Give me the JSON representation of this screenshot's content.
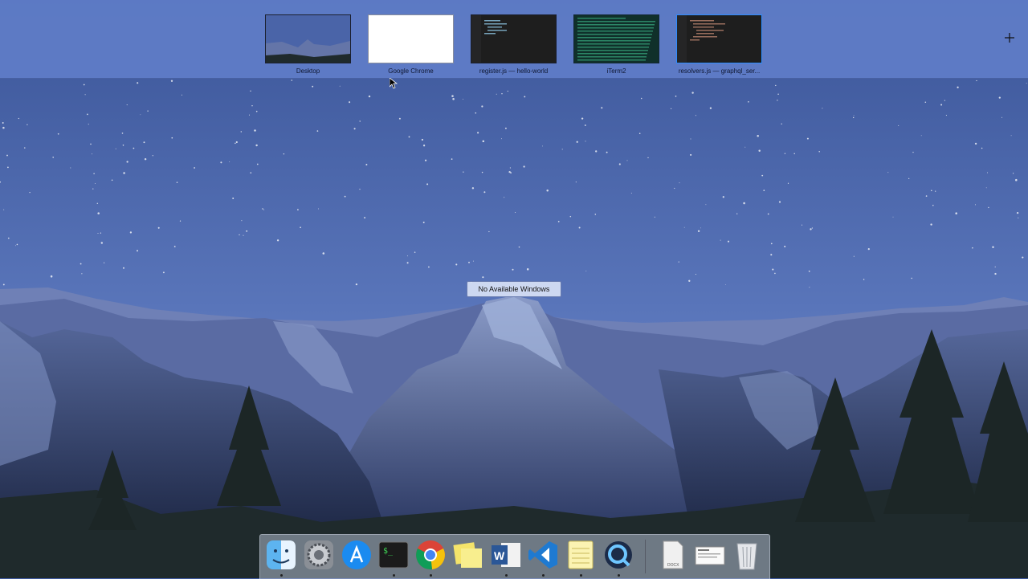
{
  "spaces": [
    {
      "label": "Desktop",
      "kind": "desktop"
    },
    {
      "label": "Google Chrome",
      "kind": "blank"
    },
    {
      "label": "register.js — hello-world",
      "kind": "code"
    },
    {
      "label": "iTerm2",
      "kind": "terminal"
    },
    {
      "label": "resolvers.js — graphql_ser...",
      "kind": "code-selected"
    }
  ],
  "add_space_icon": "plus-icon",
  "message": "No Available Windows",
  "dock": {
    "apps": [
      {
        "name": "finder-icon",
        "running": true
      },
      {
        "name": "system-preferences-icon",
        "running": false
      },
      {
        "name": "app-store-icon",
        "running": false
      },
      {
        "name": "terminal-icon",
        "running": true
      },
      {
        "name": "chrome-icon",
        "running": true
      },
      {
        "name": "stickies-icon",
        "running": false
      },
      {
        "name": "word-icon",
        "running": true
      },
      {
        "name": "vscode-icon",
        "running": true
      },
      {
        "name": "notes-icon",
        "running": true
      },
      {
        "name": "quicktime-icon",
        "running": true
      }
    ],
    "stack_label": "DOCX",
    "extras": [
      "docx-file-icon",
      "screenshot-stack-icon",
      "trash-icon"
    ]
  },
  "colors": {
    "sky_top": "#3e5a9c",
    "sky_bottom": "#6c87c4",
    "spaces_bar": "#5f7dc8",
    "selected_border": "#2d8cff"
  }
}
